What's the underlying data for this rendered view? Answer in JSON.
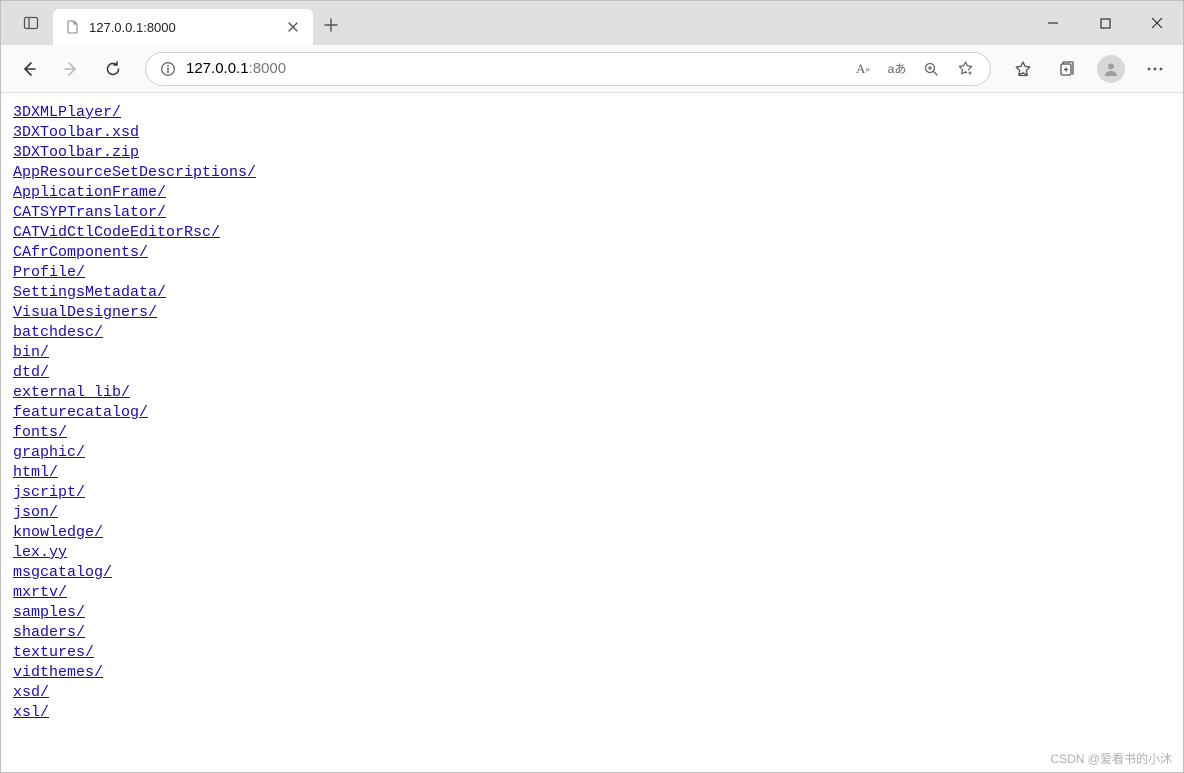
{
  "tab": {
    "title": "127.0.0.1:8000"
  },
  "url": {
    "host": "127.0.0.1",
    "port": ":8000"
  },
  "toolbar_icons": {
    "read_aloud": "Aᵃ",
    "translate": "aあ"
  },
  "listing": [
    "3DXMLPlayer/",
    "3DXToolbar.xsd",
    "3DXToolbar.zip",
    "AppResourceSetDescriptions/",
    "ApplicationFrame/",
    "CATSYPTranslator/",
    "CATVidCtlCodeEditorRsc/",
    "CAfrComponents/",
    "Profile/",
    "SettingsMetadata/",
    "VisualDesigners/",
    "batchdesc/",
    "bin/",
    "dtd/",
    "external_lib/",
    "featurecatalog/",
    "fonts/",
    "graphic/",
    "html/",
    "jscript/",
    "json/",
    "knowledge/",
    "lex.yy",
    "msgcatalog/",
    "mxrtv/",
    "samples/",
    "shaders/",
    "textures/",
    "vidthemes/",
    "xsd/",
    "xsl/"
  ],
  "watermark": "CSDN @爱看书的小沐"
}
